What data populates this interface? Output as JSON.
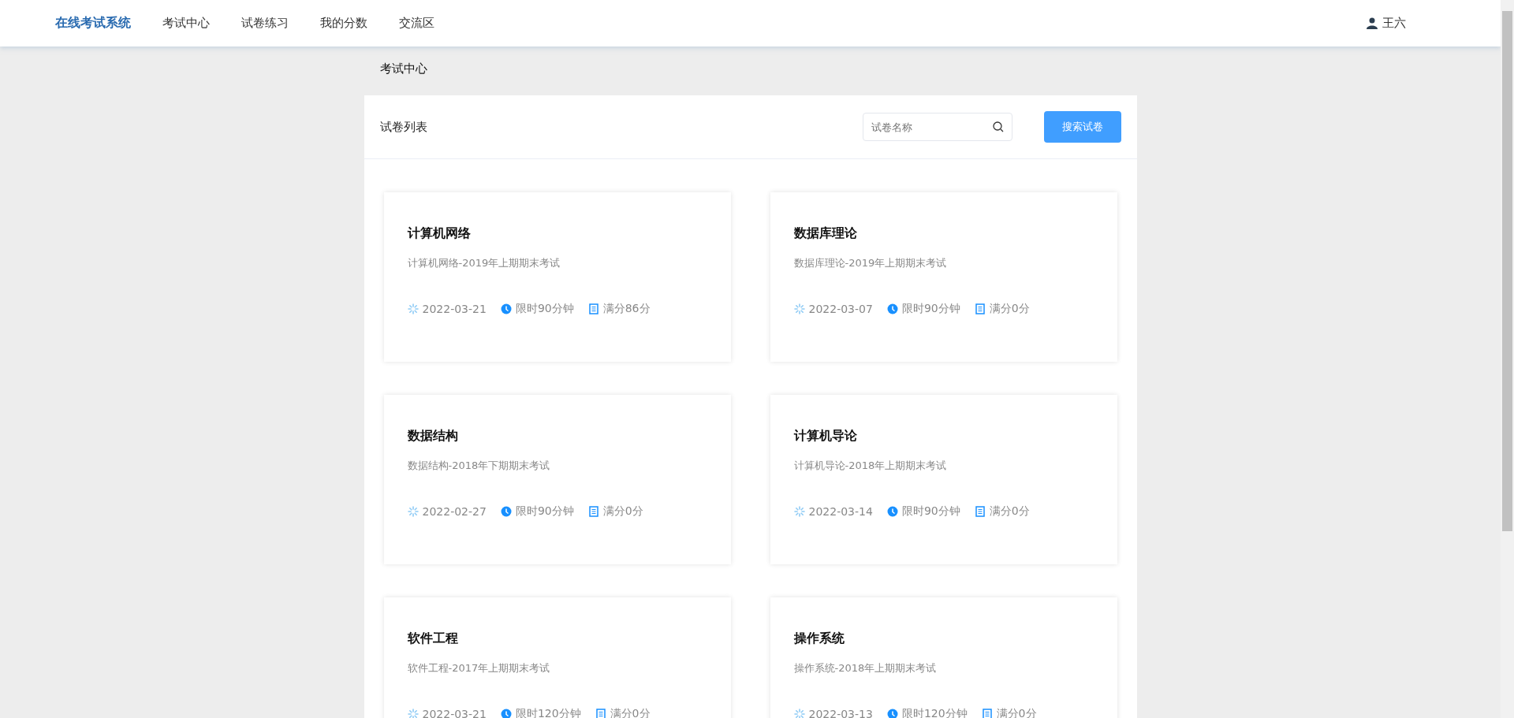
{
  "header": {
    "logo": "在线考试系统",
    "nav": [
      {
        "label": "考试中心"
      },
      {
        "label": "试卷练习"
      },
      {
        "label": "我的分数"
      },
      {
        "label": "交流区"
      }
    ],
    "user": "王六"
  },
  "breadcrumb": "考试中心",
  "panel": {
    "title": "试卷列表",
    "search": {
      "placeholder": "试卷名称"
    },
    "button": "搜索试卷"
  },
  "papers": [
    {
      "title": "计算机网络",
      "description": "计算机网络-2019年上期期末考试",
      "date": "2022-03-21",
      "duration": "限时90分钟",
      "score": "满分86分"
    },
    {
      "title": "数据库理论",
      "description": "数据库理论-2019年上期期末考试",
      "date": "2022-03-07",
      "duration": "限时90分钟",
      "score": "满分0分"
    },
    {
      "title": "数据结构",
      "description": "数据结构-2018年下期期末考试",
      "date": "2022-02-27",
      "duration": "限时90分钟",
      "score": "满分0分"
    },
    {
      "title": "计算机导论",
      "description": "计算机导论-2018年上期期末考试",
      "date": "2022-03-14",
      "duration": "限时90分钟",
      "score": "满分0分"
    },
    {
      "title": "软件工程",
      "description": "软件工程-2017年上期期末考试",
      "date": "2022-03-21",
      "duration": "限时120分钟",
      "score": "满分0分"
    },
    {
      "title": "操作系统",
      "description": "操作系统-2018年上期期末考试",
      "date": "2022-03-13",
      "duration": "限时120分钟",
      "score": "满分0分"
    }
  ]
}
